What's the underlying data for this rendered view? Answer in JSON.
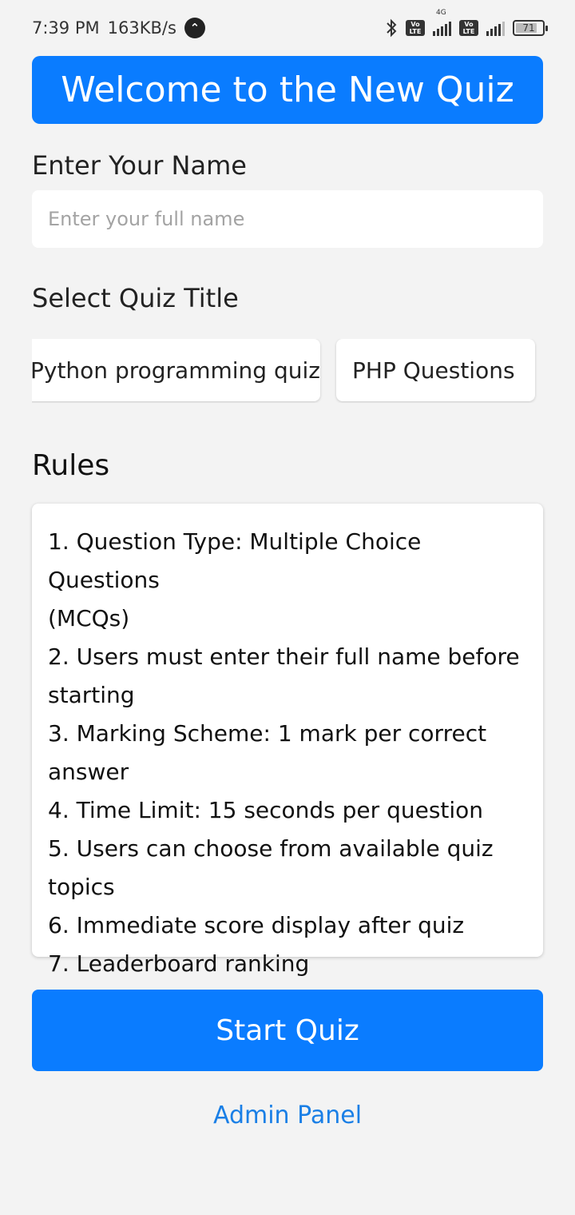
{
  "status_bar": {
    "time": "7:39 PM",
    "speed": "163KB/s",
    "network_small": "4G",
    "volte_1": "Vo LTE",
    "volte_2": "Vo LTE",
    "battery": "71",
    "battery_level": 0.71,
    "icons": [
      "navigation-arrow-icon",
      "bluetooth-icon",
      "signal-icon",
      "battery-icon"
    ]
  },
  "header": {
    "title": "Welcome to the New Quiz"
  },
  "name_section": {
    "label": "Enter Your Name",
    "input_value": "",
    "placeholder": "Enter your full name"
  },
  "quiz_section": {
    "label": "Select Quiz Title",
    "options": [
      "Python programming quiz",
      "PHP Questions"
    ]
  },
  "rules": {
    "title": "Rules",
    "lines": [
      "1. Question Type: Multiple Choice Questions",
      "(MCQs)",
      "2. Users must enter their full name before",
      "starting",
      "3. Marking Scheme: 1 mark per correct",
      "answer",
      "4. Time Limit: 15 seconds per question",
      "5. Users can choose from available quiz",
      "topics",
      "6. Immediate score display after quiz",
      "7. Leaderboard ranking"
    ]
  },
  "actions": {
    "start_label": "Start Quiz",
    "admin_label": "Admin Panel"
  },
  "colors": {
    "accent": "#0a7cff",
    "link": "#1a7fe6",
    "background": "#f3f3f3"
  }
}
